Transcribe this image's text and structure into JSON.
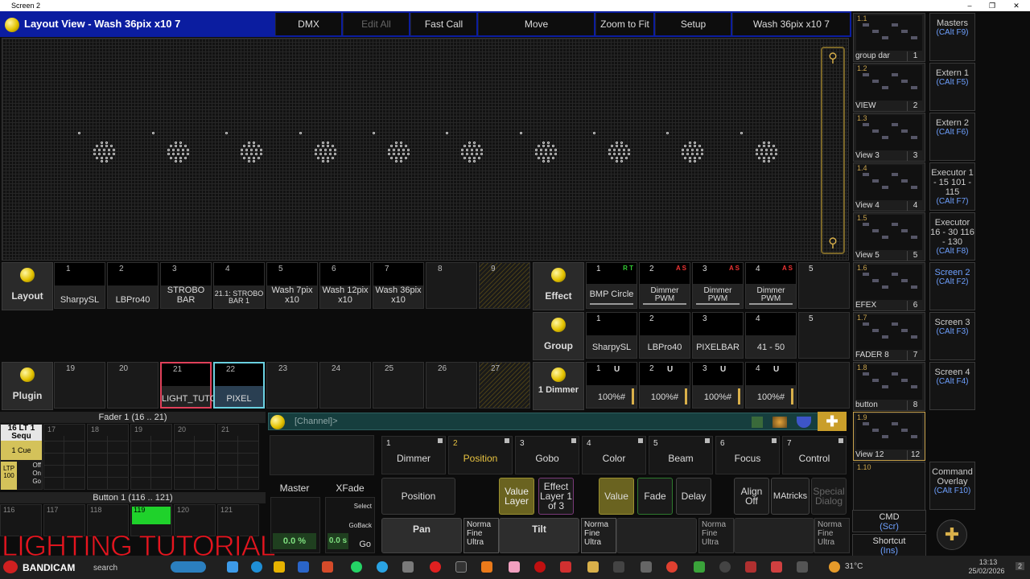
{
  "window": {
    "title": "Screen 2",
    "minimize": "–",
    "restore": "❐",
    "close": "✕"
  },
  "topbar": {
    "title": "Layout View - Wash 36pix x10 7",
    "buttons": [
      {
        "label": "DMX",
        "enabled": true
      },
      {
        "label": "Edit All",
        "enabled": false
      },
      {
        "label": "Fast Call",
        "enabled": true
      },
      {
        "label": "Move",
        "enabled": true
      },
      {
        "label": "Zoom to Fit",
        "enabled": true
      },
      {
        "label": "Setup",
        "enabled": true
      },
      {
        "label": "Wash 36pix x10 7",
        "enabled": true
      }
    ]
  },
  "layout_pool": {
    "label": "Layout",
    "cells": [
      {
        "n": "1",
        "label": "SharpySL"
      },
      {
        "n": "2",
        "label": "LBPro40"
      },
      {
        "n": "3",
        "label": "STROBO BAR"
      },
      {
        "n": "4",
        "label": "21.1: STROBO BAR 1"
      },
      {
        "n": "5",
        "label": "Wash 7pix x10"
      },
      {
        "n": "6",
        "label": "Wash 12pix x10"
      },
      {
        "n": "7",
        "label": "Wash 36pix x10"
      },
      {
        "n": "8",
        "label": ""
      },
      {
        "n": "9",
        "label": ""
      }
    ]
  },
  "plugin_pool": {
    "label": "Plugin",
    "cells": [
      {
        "n": "19",
        "label": ""
      },
      {
        "n": "20",
        "label": ""
      },
      {
        "n": "21",
        "label": "LIGHT_TUTOR"
      },
      {
        "n": "22",
        "label": "PIXEL"
      },
      {
        "n": "23",
        "label": ""
      },
      {
        "n": "24",
        "label": ""
      },
      {
        "n": "25",
        "label": ""
      },
      {
        "n": "26",
        "label": ""
      },
      {
        "n": "27",
        "label": ""
      }
    ]
  },
  "effect_pool": {
    "label": "Effect",
    "cells": [
      {
        "n": "1",
        "tag": "R T",
        "label": "BMP Circle"
      },
      {
        "n": "2",
        "tag": "A S",
        "label": "Dimmer PWM"
      },
      {
        "n": "3",
        "tag": "A S",
        "label": "Dimmer PWM"
      },
      {
        "n": "4",
        "tag": "A S",
        "label": "Dimmer PWM"
      },
      {
        "n": "5",
        "tag": "",
        "label": ""
      }
    ]
  },
  "group_pool": {
    "label": "Group",
    "cells": [
      {
        "n": "1",
        "label": "SharpySL"
      },
      {
        "n": "2",
        "label": "LBPro40"
      },
      {
        "n": "3",
        "label": "PIXELBAR"
      },
      {
        "n": "4",
        "label": "41 - 50"
      },
      {
        "n": "5",
        "label": ""
      }
    ]
  },
  "dimmer_pool": {
    "label": "1 Dimmer",
    "cells": [
      {
        "n": "1",
        "u": "U",
        "label": "100%#"
      },
      {
        "n": "2",
        "u": "U",
        "label": "100%#"
      },
      {
        "n": "3",
        "u": "U",
        "label": "100%#"
      },
      {
        "n": "4",
        "u": "U",
        "label": "100%#"
      }
    ]
  },
  "views": [
    {
      "num": "1.1",
      "name": "group dar",
      "page": "1"
    },
    {
      "num": "1.2",
      "name": "VIEW",
      "page": "2"
    },
    {
      "num": "1.3",
      "name": "View 3",
      "page": "3"
    },
    {
      "num": "1.4",
      "name": "View 4",
      "page": "4"
    },
    {
      "num": "1.5",
      "name": "View 5",
      "page": "5"
    },
    {
      "num": "1.6",
      "name": "EFEX",
      "page": "6"
    },
    {
      "num": "1.7",
      "name": "FADER 8",
      "page": "7"
    },
    {
      "num": "1.8",
      "name": "button",
      "page": "8"
    },
    {
      "num": "1.9",
      "name": "View 12",
      "page": "12"
    },
    {
      "num": "1.10",
      "name": "",
      "page": ""
    }
  ],
  "side": [
    {
      "label": "Masters",
      "key": "(CAlt F9)"
    },
    {
      "label": "Extern 1",
      "key": "(CAlt F5)"
    },
    {
      "label": "Extern 2",
      "key": "(CAlt F6)"
    },
    {
      "label": "Executor 1 - 15 101 - 115",
      "key": "(CAlt F7)"
    },
    {
      "label": "Executor 16 - 30 116 - 130",
      "key": "(CAlt F8)"
    },
    {
      "label": "Screen 2",
      "key": "(CAlt F2)"
    },
    {
      "label": "Screen 3",
      "key": "(CAlt F3)"
    },
    {
      "label": "Screen 4",
      "key": "(CAlt F4)"
    },
    {
      "label": "",
      "key": ""
    },
    {
      "label": "Command Overlay",
      "key": "(CAlt F10)"
    }
  ],
  "cmd_side": {
    "cmd": "CMD",
    "cmd_key": "(Scr)",
    "shortcut": "Shortcut",
    "shortcut_key": "(Ins)"
  },
  "faders": {
    "title": "Fader  1 (16 .. 21)",
    "numbers": [
      "17",
      "18",
      "19",
      "20",
      "21"
    ],
    "lt_num": "16",
    "lt": "LT",
    "lt_num2": "1",
    "sequ": "Sequ",
    "cue": "1 Cue",
    "ltp": "LTP 100",
    "off": "Off",
    "on": "On",
    "go": "Go"
  },
  "buttons": {
    "title": "Button  1 (116 .. 121)",
    "numbers": [
      "116",
      "117",
      "118",
      "119",
      "120",
      "121"
    ]
  },
  "master": {
    "label": "Master",
    "value": "0.0 %",
    "xfade": "XFade",
    "xvalue": "0.0 s",
    "select": "Select",
    "goback": "GoBack",
    "go": "Go"
  },
  "command": {
    "text": "[Channel]>"
  },
  "feature_tabs": [
    {
      "n": "1",
      "label": "Dimmer",
      "active": false
    },
    {
      "n": "2",
      "label": "Position",
      "active": true
    },
    {
      "n": "3",
      "label": "Gobo",
      "active": false
    },
    {
      "n": "4",
      "label": "Color",
      "active": false
    },
    {
      "n": "5",
      "label": "Beam",
      "active": false
    },
    {
      "n": "6",
      "label": "Focus",
      "active": false
    },
    {
      "n": "7",
      "label": "Control",
      "active": false
    }
  ],
  "controls": {
    "position": "Position",
    "value_layer": "Value Layer",
    "effect_layer": "Effect Layer 1 of 3",
    "value": "Value",
    "fade": "Fade",
    "delay": "Delay",
    "align": "Align Off",
    "matricks": "MAtricks",
    "special": "Special Dialog"
  },
  "encoders": [
    {
      "label": "Pan",
      "sub": "Norma Fine Ultra"
    },
    {
      "label": "Tilt",
      "sub": "Norma Fine Ultra"
    },
    {
      "label": "",
      "sub": "Norma Fine Ultra"
    },
    {
      "label": "",
      "sub": "Norma Fine Ultra"
    }
  ],
  "overlay": {
    "text": "LIGHTING TUTORIAL"
  },
  "taskbar": {
    "rec": "BANDICAM",
    "search": "search",
    "temp": "31°C",
    "time": "13:13",
    "date": "25/02/2026",
    "notif": "2"
  }
}
